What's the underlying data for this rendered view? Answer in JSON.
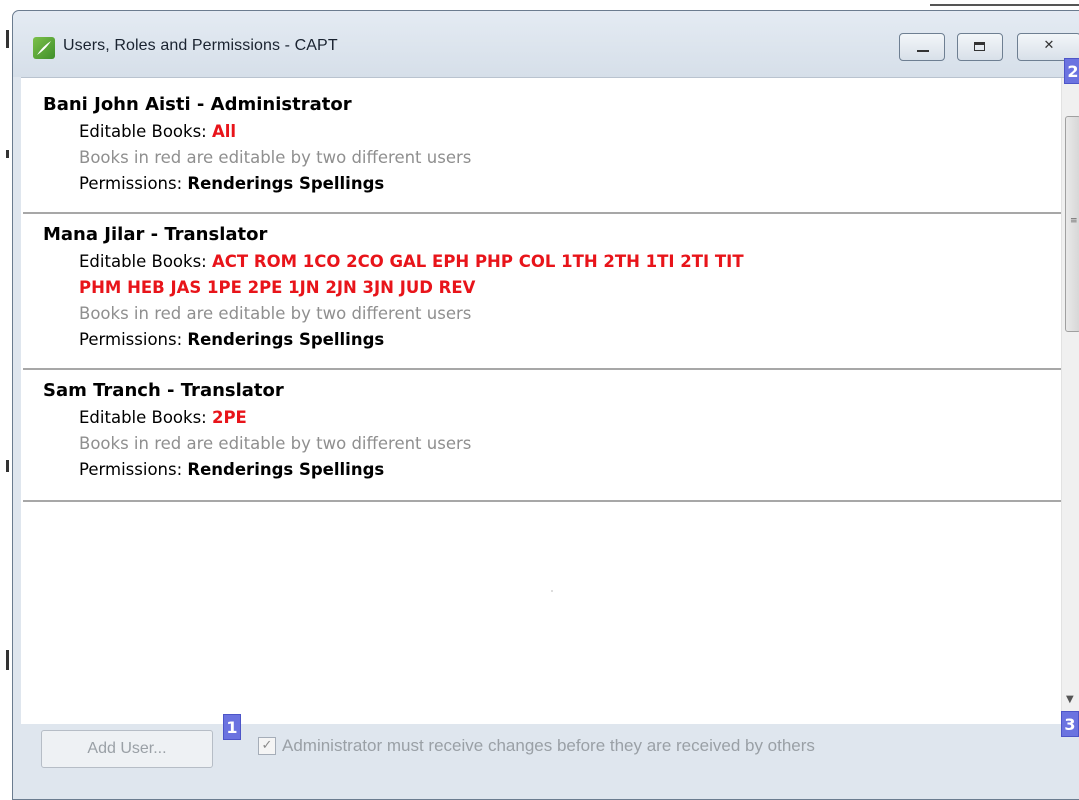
{
  "window": {
    "title": "Users, Roles and Permissions - CAPT",
    "app_icon": "green-leaf-icon",
    "controls": [
      "minimize-icon",
      "maximize-icon",
      "close-icon"
    ]
  },
  "users": [
    {
      "name": "Bani John Aisti  - Administrator",
      "editable_label": "Editable Books: ",
      "editable_books_line1": "All",
      "editable_books_line2": "",
      "note": "Books in red are editable by two different users",
      "permissions_label": "Permissions: ",
      "permissions": "Renderings Spellings"
    },
    {
      "name": "Mana Jilar - Translator",
      "editable_label": "Editable Books: ",
      "editable_books_line1": "ACT ROM 1CO 2CO GAL EPH PHP COL 1TH 2TH 1TI 2TI TIT",
      "editable_books_line2": "PHM HEB JAS 1PE 2PE 1JN 2JN 3JN JUD REV",
      "note": "Books in red are editable by two different users",
      "permissions_label": "Permissions: ",
      "permissions": "Renderings Spellings"
    },
    {
      "name": "Sam Tranch - Translator",
      "editable_label": "Editable Books: ",
      "editable_books_line1": "2PE",
      "editable_books_line2": "",
      "note": "Books in red are editable by two different users",
      "permissions_label": "Permissions: ",
      "permissions": "Renderings Spellings"
    }
  ],
  "footer": {
    "add_user_label": "Add User...",
    "admin_check_label": "Administrator must receive changes before they are received by others",
    "admin_check_checked": true
  },
  "badges": {
    "b1": "1",
    "b2": "2",
    "b3": "3"
  },
  "colors": {
    "red_books": "#e8141a",
    "note_grey": "#8f8f8f",
    "badge_blue": "#6b73e0"
  }
}
